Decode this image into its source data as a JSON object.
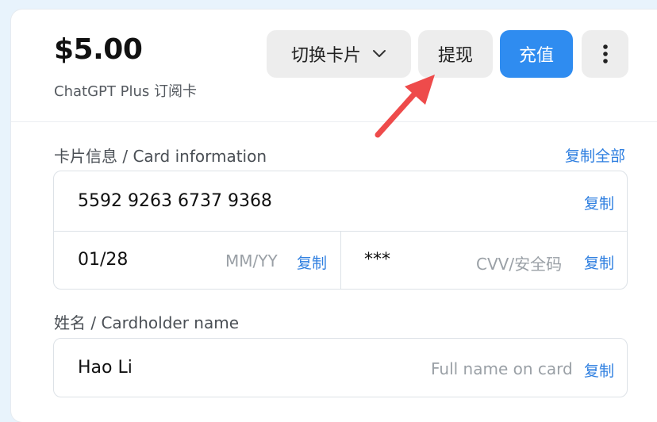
{
  "header": {
    "balance": "$5.00",
    "subtitle": "ChatGPT Plus 订阅卡",
    "switch_card_label": "切换卡片",
    "withdraw_label": "提现",
    "recharge_label": "充值"
  },
  "card_info": {
    "section_label": "卡片信息 / Card information",
    "copy_all_label": "复制全部",
    "card_number": "5592 9263 6737 9368",
    "expiry": "01/28",
    "expiry_placeholder": "MM/YY",
    "cvv": "***",
    "cvv_placeholder": "CVV/安全码",
    "copy_label": "复制"
  },
  "cardholder": {
    "section_label": "姓名 / Cardholder name",
    "name": "Hao Li",
    "name_placeholder": "Full name on card",
    "copy_label": "复制"
  },
  "colors": {
    "primary": "#2f8cf0",
    "link": "#2f7fe0",
    "arrow": "#ee4b4b"
  },
  "icons": {
    "switch_chevron": "chevron-down-icon",
    "more": "more-vertical-icon",
    "annotation": "red-arrow-icon"
  }
}
